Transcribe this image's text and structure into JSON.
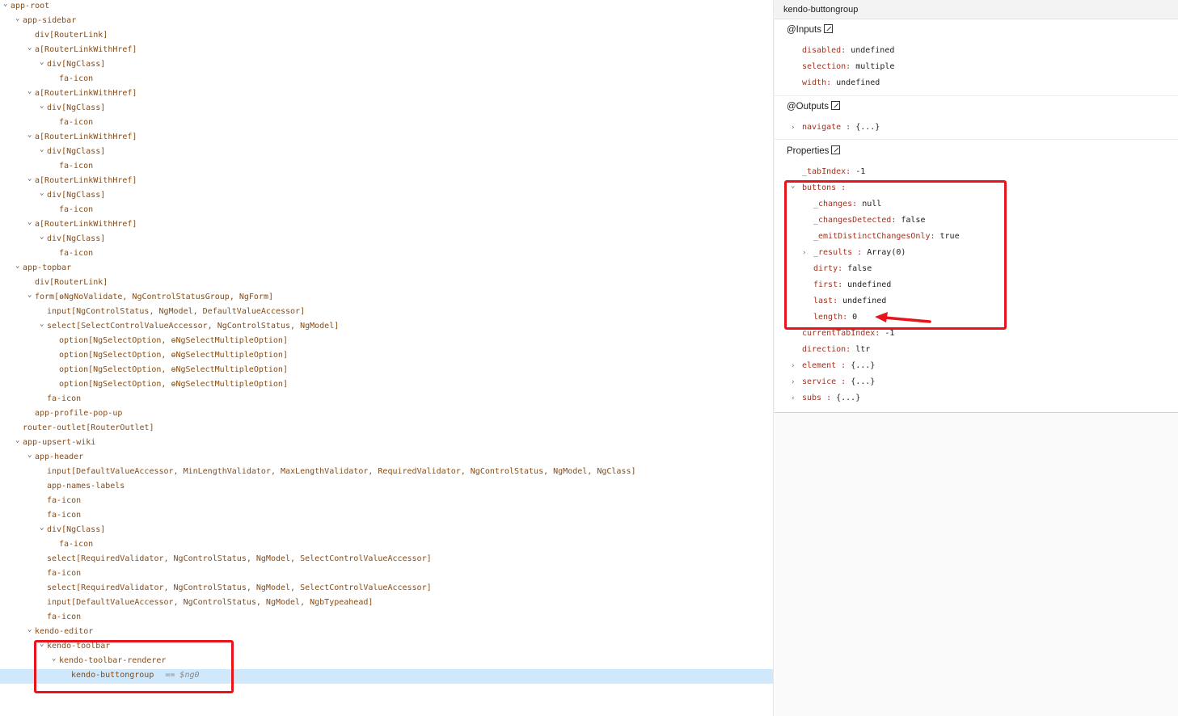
{
  "tree": {
    "nodes": [
      {
        "name": "app-root",
        "directives": "",
        "expanded": true
      },
      {
        "name": "app-sidebar",
        "directives": "",
        "expanded": true
      },
      {
        "name": "div",
        "directives": "[RouterLink]",
        "expanded": false
      },
      {
        "name": "a",
        "directives": "[RouterLinkWithHref]",
        "expanded": true
      },
      {
        "name": "div",
        "directives": "[NgClass]",
        "expanded": true
      },
      {
        "name": "fa-icon",
        "directives": "",
        "expanded": false
      },
      {
        "name": "a",
        "directives": "[RouterLinkWithHref]",
        "expanded": true
      },
      {
        "name": "div",
        "directives": "[NgClass]",
        "expanded": true
      },
      {
        "name": "fa-icon",
        "directives": "",
        "expanded": false
      },
      {
        "name": "a",
        "directives": "[RouterLinkWithHref]",
        "expanded": true
      },
      {
        "name": "div",
        "directives": "[NgClass]",
        "expanded": true
      },
      {
        "name": "fa-icon",
        "directives": "",
        "expanded": false
      },
      {
        "name": "a",
        "directives": "[RouterLinkWithHref]",
        "expanded": true
      },
      {
        "name": "div",
        "directives": "[NgClass]",
        "expanded": true
      },
      {
        "name": "fa-icon",
        "directives": "",
        "expanded": false
      },
      {
        "name": "a",
        "directives": "[RouterLinkWithHref]",
        "expanded": true
      },
      {
        "name": "div",
        "directives": "[NgClass]",
        "expanded": true
      },
      {
        "name": "fa-icon",
        "directives": "",
        "expanded": false
      },
      {
        "name": "app-topbar",
        "directives": "",
        "expanded": true
      },
      {
        "name": "div",
        "directives": "[RouterLink]",
        "expanded": false
      },
      {
        "name": "form",
        "directives": "[ɵNgNoValidate, NgControlStatusGroup, NgForm]",
        "expanded": true
      },
      {
        "name": "input",
        "directives": "[NgControlStatus, NgModel, DefaultValueAccessor]",
        "expanded": false
      },
      {
        "name": "select",
        "directives": "[SelectControlValueAccessor, NgControlStatus, NgModel]",
        "expanded": true
      },
      {
        "name": "option",
        "directives": "[NgSelectOption, ɵNgSelectMultipleOption]",
        "expanded": false
      },
      {
        "name": "option",
        "directives": "[NgSelectOption, ɵNgSelectMultipleOption]",
        "expanded": false
      },
      {
        "name": "option",
        "directives": "[NgSelectOption, ɵNgSelectMultipleOption]",
        "expanded": false
      },
      {
        "name": "option",
        "directives": "[NgSelectOption, ɵNgSelectMultipleOption]",
        "expanded": false
      },
      {
        "name": "fa-icon",
        "directives": "",
        "expanded": false
      },
      {
        "name": "app-profile-pop-up",
        "directives": "",
        "expanded": false
      },
      {
        "name": "router-outlet",
        "directives": "[RouterOutlet]",
        "expanded": false
      },
      {
        "name": "app-upsert-wiki",
        "directives": "",
        "expanded": true
      },
      {
        "name": "app-header",
        "directives": "",
        "expanded": true
      },
      {
        "name": "input",
        "directives": "[DefaultValueAccessor, MinLengthValidator, MaxLengthValidator, RequiredValidator, NgControlStatus, NgModel, NgClass]",
        "expanded": false
      },
      {
        "name": "app-names-labels",
        "directives": "",
        "expanded": false
      },
      {
        "name": "fa-icon",
        "directives": "",
        "expanded": false
      },
      {
        "name": "fa-icon",
        "directives": "",
        "expanded": false
      },
      {
        "name": "div",
        "directives": "[NgClass]",
        "expanded": true
      },
      {
        "name": "fa-icon",
        "directives": "",
        "expanded": false
      },
      {
        "name": "select",
        "directives": "[RequiredValidator, NgControlStatus, NgModel, SelectControlValueAccessor]",
        "expanded": false
      },
      {
        "name": "fa-icon",
        "directives": "",
        "expanded": false
      },
      {
        "name": "select",
        "directives": "[RequiredValidator, NgControlStatus, NgModel, SelectControlValueAccessor]",
        "expanded": false
      },
      {
        "name": "input",
        "directives": "[DefaultValueAccessor, NgControlStatus, NgModel, NgbTypeahead]",
        "expanded": false
      },
      {
        "name": "fa-icon",
        "directives": "",
        "expanded": false
      },
      {
        "name": "kendo-editor",
        "directives": "",
        "expanded": true
      },
      {
        "name": "kendo-toolbar",
        "directives": "",
        "expanded": true
      },
      {
        "name": "kendo-toolbar-renderer",
        "directives": "",
        "expanded": true
      },
      {
        "name": "kendo-buttongroup",
        "directives": "",
        "expanded": false,
        "selected": true,
        "ref": "== $ng0"
      }
    ]
  },
  "panel": {
    "title": "kendo-buttongroup",
    "inputs_title": "@Inputs",
    "inputs": [
      {
        "key": "disabled:",
        "value": "undefined"
      },
      {
        "key": "selection:",
        "value": "multiple"
      },
      {
        "key": "width:",
        "value": "undefined"
      }
    ],
    "outputs_title": "@Outputs",
    "outputs": [
      {
        "key": "navigate :",
        "value": "{...}",
        "collapsed": true
      }
    ],
    "properties_title": "Properties",
    "properties": [
      {
        "key": "_tabIndex:",
        "value": "-1",
        "caret": ""
      },
      {
        "key": "buttons :",
        "value": "",
        "caret": "open"
      },
      {
        "key": "_changes:",
        "value": "null",
        "caret": "",
        "child": true
      },
      {
        "key": "_changesDetected:",
        "value": "false",
        "caret": "",
        "child": true
      },
      {
        "key": "_emitDistinctChangesOnly:",
        "value": "true",
        "caret": "",
        "child": true
      },
      {
        "key": "_results :",
        "value": "Array(0)",
        "caret": "closed",
        "child": true
      },
      {
        "key": "dirty:",
        "value": "false",
        "caret": "",
        "child": true
      },
      {
        "key": "first:",
        "value": "undefined",
        "caret": "",
        "child": true
      },
      {
        "key": "last:",
        "value": "undefined",
        "caret": "",
        "child": true
      },
      {
        "key": "length:",
        "value": "0",
        "caret": "",
        "child": true
      },
      {
        "key": "currentTabIndex:",
        "value": "-1",
        "caret": ""
      },
      {
        "key": "direction:",
        "value": "ltr",
        "caret": ""
      },
      {
        "key": "element :",
        "value": "{...}",
        "caret": "closed"
      },
      {
        "key": "service :",
        "value": "{...}",
        "caret": "closed"
      },
      {
        "key": "subs :",
        "value": "{...}",
        "caret": "closed"
      }
    ]
  },
  "colors": {
    "annotation_red": "#e8141c",
    "selection_blue": "#cfe8fc",
    "node_brown": "#8a4b12",
    "prop_key_red": "#a1321f"
  }
}
